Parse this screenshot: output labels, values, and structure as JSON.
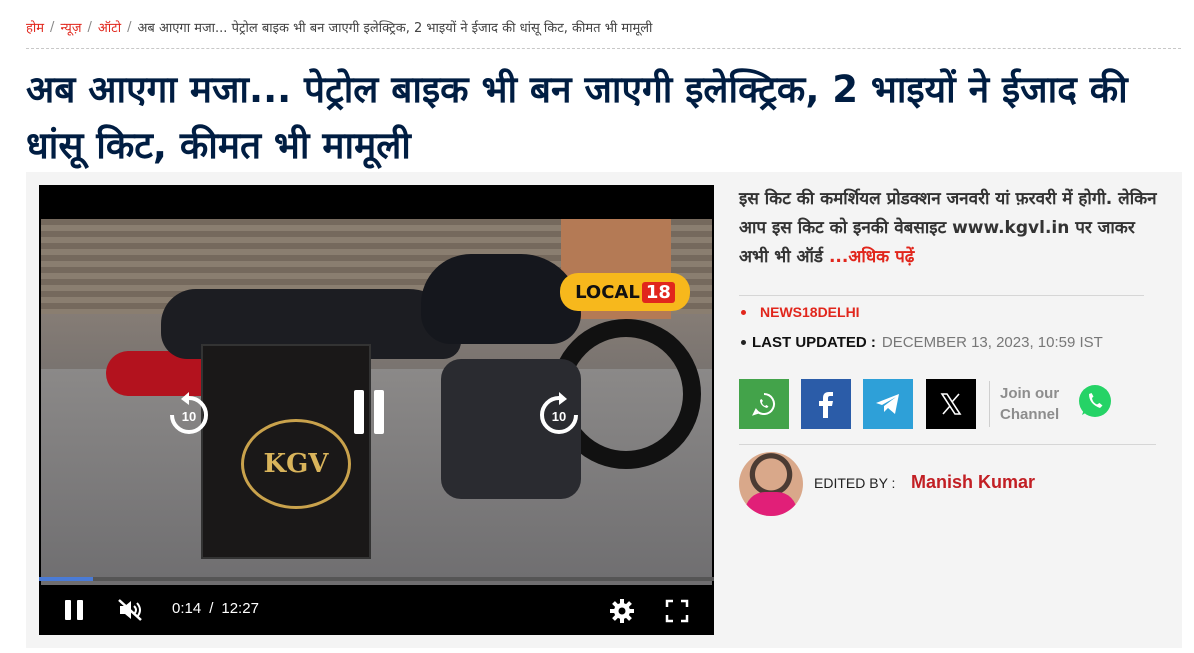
{
  "breadcrumb": {
    "home": "होम",
    "news": "न्यूज़",
    "auto": "ऑटो",
    "current": "अब आएगा मजा... पेट्रोल बाइक भी बन जाएगी इलेक्ट्रिक, 2 भाइयों ने ईजाद की धांसू किट, कीमत भी मामूली",
    "separator": "/"
  },
  "article": {
    "title": "अब आएगा मजा... पेट्रोल बाइक भी बन जाएगी इलेक्ट्रिक, 2 भाइयों ने ईजाद की धांसू किट, कीमत भी मामूली",
    "summary": "इस किट की कमर्शियल प्रोडक्शन जनवरी यां फ़रवरी में होगी. लेकिन आप इस किट को इनकी वेबसाइट www.kgvl.in पर जाकर अभी भी ऑर्ड",
    "read_more": "...अधिक पढ़ें",
    "source": "NEWS18DELHI",
    "last_updated_label": "LAST UPDATED :",
    "last_updated_value": "DECEMBER 13, 2023, 10:59 IST",
    "edited_by_label": "EDITED BY :",
    "editor": "Manish Kumar"
  },
  "video": {
    "badge_text": "LOCAL",
    "badge_number": "18",
    "box_logo": "KGV",
    "rewind_seconds": "10",
    "forward_seconds": "10",
    "current_time": "0:14",
    "time_separator": "/",
    "duration": "12:27",
    "progress_fraction": 0.019,
    "muted": true
  },
  "share": {
    "join_line1": "Join our",
    "join_line2": "Channel"
  },
  "colors": {
    "accent_red": "#e1261c",
    "title_navy": "#001d42",
    "whatsapp": "#43a34a",
    "facebook": "#2b5ca8",
    "telegram": "#2ea0d8"
  }
}
